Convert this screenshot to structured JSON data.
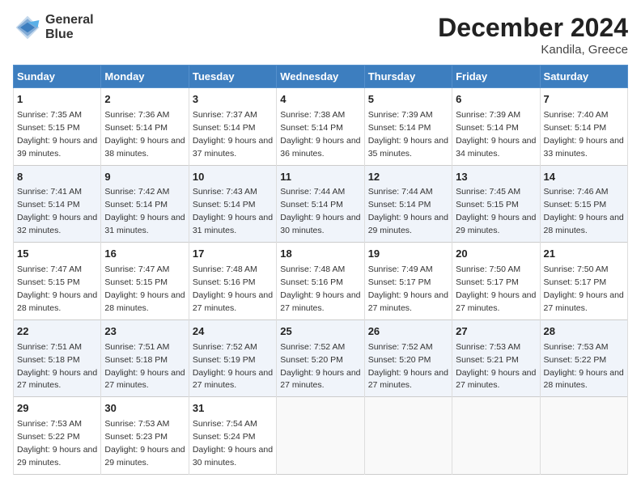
{
  "logo": {
    "line1": "General",
    "line2": "Blue"
  },
  "title": "December 2024",
  "subtitle": "Kandila, Greece",
  "days_of_week": [
    "Sunday",
    "Monday",
    "Tuesday",
    "Wednesday",
    "Thursday",
    "Friday",
    "Saturday"
  ],
  "weeks": [
    [
      {
        "day": "1",
        "sunrise": "7:35 AM",
        "sunset": "5:15 PM",
        "daylight": "9 hours and 39 minutes."
      },
      {
        "day": "2",
        "sunrise": "7:36 AM",
        "sunset": "5:14 PM",
        "daylight": "9 hours and 38 minutes."
      },
      {
        "day": "3",
        "sunrise": "7:37 AM",
        "sunset": "5:14 PM",
        "daylight": "9 hours and 37 minutes."
      },
      {
        "day": "4",
        "sunrise": "7:38 AM",
        "sunset": "5:14 PM",
        "daylight": "9 hours and 36 minutes."
      },
      {
        "day": "5",
        "sunrise": "7:39 AM",
        "sunset": "5:14 PM",
        "daylight": "9 hours and 35 minutes."
      },
      {
        "day": "6",
        "sunrise": "7:39 AM",
        "sunset": "5:14 PM",
        "daylight": "9 hours and 34 minutes."
      },
      {
        "day": "7",
        "sunrise": "7:40 AM",
        "sunset": "5:14 PM",
        "daylight": "9 hours and 33 minutes."
      }
    ],
    [
      {
        "day": "8",
        "sunrise": "7:41 AM",
        "sunset": "5:14 PM",
        "daylight": "9 hours and 32 minutes."
      },
      {
        "day": "9",
        "sunrise": "7:42 AM",
        "sunset": "5:14 PM",
        "daylight": "9 hours and 31 minutes."
      },
      {
        "day": "10",
        "sunrise": "7:43 AM",
        "sunset": "5:14 PM",
        "daylight": "9 hours and 31 minutes."
      },
      {
        "day": "11",
        "sunrise": "7:44 AM",
        "sunset": "5:14 PM",
        "daylight": "9 hours and 30 minutes."
      },
      {
        "day": "12",
        "sunrise": "7:44 AM",
        "sunset": "5:14 PM",
        "daylight": "9 hours and 29 minutes."
      },
      {
        "day": "13",
        "sunrise": "7:45 AM",
        "sunset": "5:15 PM",
        "daylight": "9 hours and 29 minutes."
      },
      {
        "day": "14",
        "sunrise": "7:46 AM",
        "sunset": "5:15 PM",
        "daylight": "9 hours and 28 minutes."
      }
    ],
    [
      {
        "day": "15",
        "sunrise": "7:47 AM",
        "sunset": "5:15 PM",
        "daylight": "9 hours and 28 minutes."
      },
      {
        "day": "16",
        "sunrise": "7:47 AM",
        "sunset": "5:15 PM",
        "daylight": "9 hours and 28 minutes."
      },
      {
        "day": "17",
        "sunrise": "7:48 AM",
        "sunset": "5:16 PM",
        "daylight": "9 hours and 27 minutes."
      },
      {
        "day": "18",
        "sunrise": "7:48 AM",
        "sunset": "5:16 PM",
        "daylight": "9 hours and 27 minutes."
      },
      {
        "day": "19",
        "sunrise": "7:49 AM",
        "sunset": "5:17 PM",
        "daylight": "9 hours and 27 minutes."
      },
      {
        "day": "20",
        "sunrise": "7:50 AM",
        "sunset": "5:17 PM",
        "daylight": "9 hours and 27 minutes."
      },
      {
        "day": "21",
        "sunrise": "7:50 AM",
        "sunset": "5:17 PM",
        "daylight": "9 hours and 27 minutes."
      }
    ],
    [
      {
        "day": "22",
        "sunrise": "7:51 AM",
        "sunset": "5:18 PM",
        "daylight": "9 hours and 27 minutes."
      },
      {
        "day": "23",
        "sunrise": "7:51 AM",
        "sunset": "5:18 PM",
        "daylight": "9 hours and 27 minutes."
      },
      {
        "day": "24",
        "sunrise": "7:52 AM",
        "sunset": "5:19 PM",
        "daylight": "9 hours and 27 minutes."
      },
      {
        "day": "25",
        "sunrise": "7:52 AM",
        "sunset": "5:20 PM",
        "daylight": "9 hours and 27 minutes."
      },
      {
        "day": "26",
        "sunrise": "7:52 AM",
        "sunset": "5:20 PM",
        "daylight": "9 hours and 27 minutes."
      },
      {
        "day": "27",
        "sunrise": "7:53 AM",
        "sunset": "5:21 PM",
        "daylight": "9 hours and 27 minutes."
      },
      {
        "day": "28",
        "sunrise": "7:53 AM",
        "sunset": "5:22 PM",
        "daylight": "9 hours and 28 minutes."
      }
    ],
    [
      {
        "day": "29",
        "sunrise": "7:53 AM",
        "sunset": "5:22 PM",
        "daylight": "9 hours and 29 minutes."
      },
      {
        "day": "30",
        "sunrise": "7:53 AM",
        "sunset": "5:23 PM",
        "daylight": "9 hours and 29 minutes."
      },
      {
        "day": "31",
        "sunrise": "7:54 AM",
        "sunset": "5:24 PM",
        "daylight": "9 hours and 30 minutes."
      },
      null,
      null,
      null,
      null
    ]
  ],
  "labels": {
    "sunrise": "Sunrise:",
    "sunset": "Sunset:",
    "daylight": "Daylight:"
  }
}
